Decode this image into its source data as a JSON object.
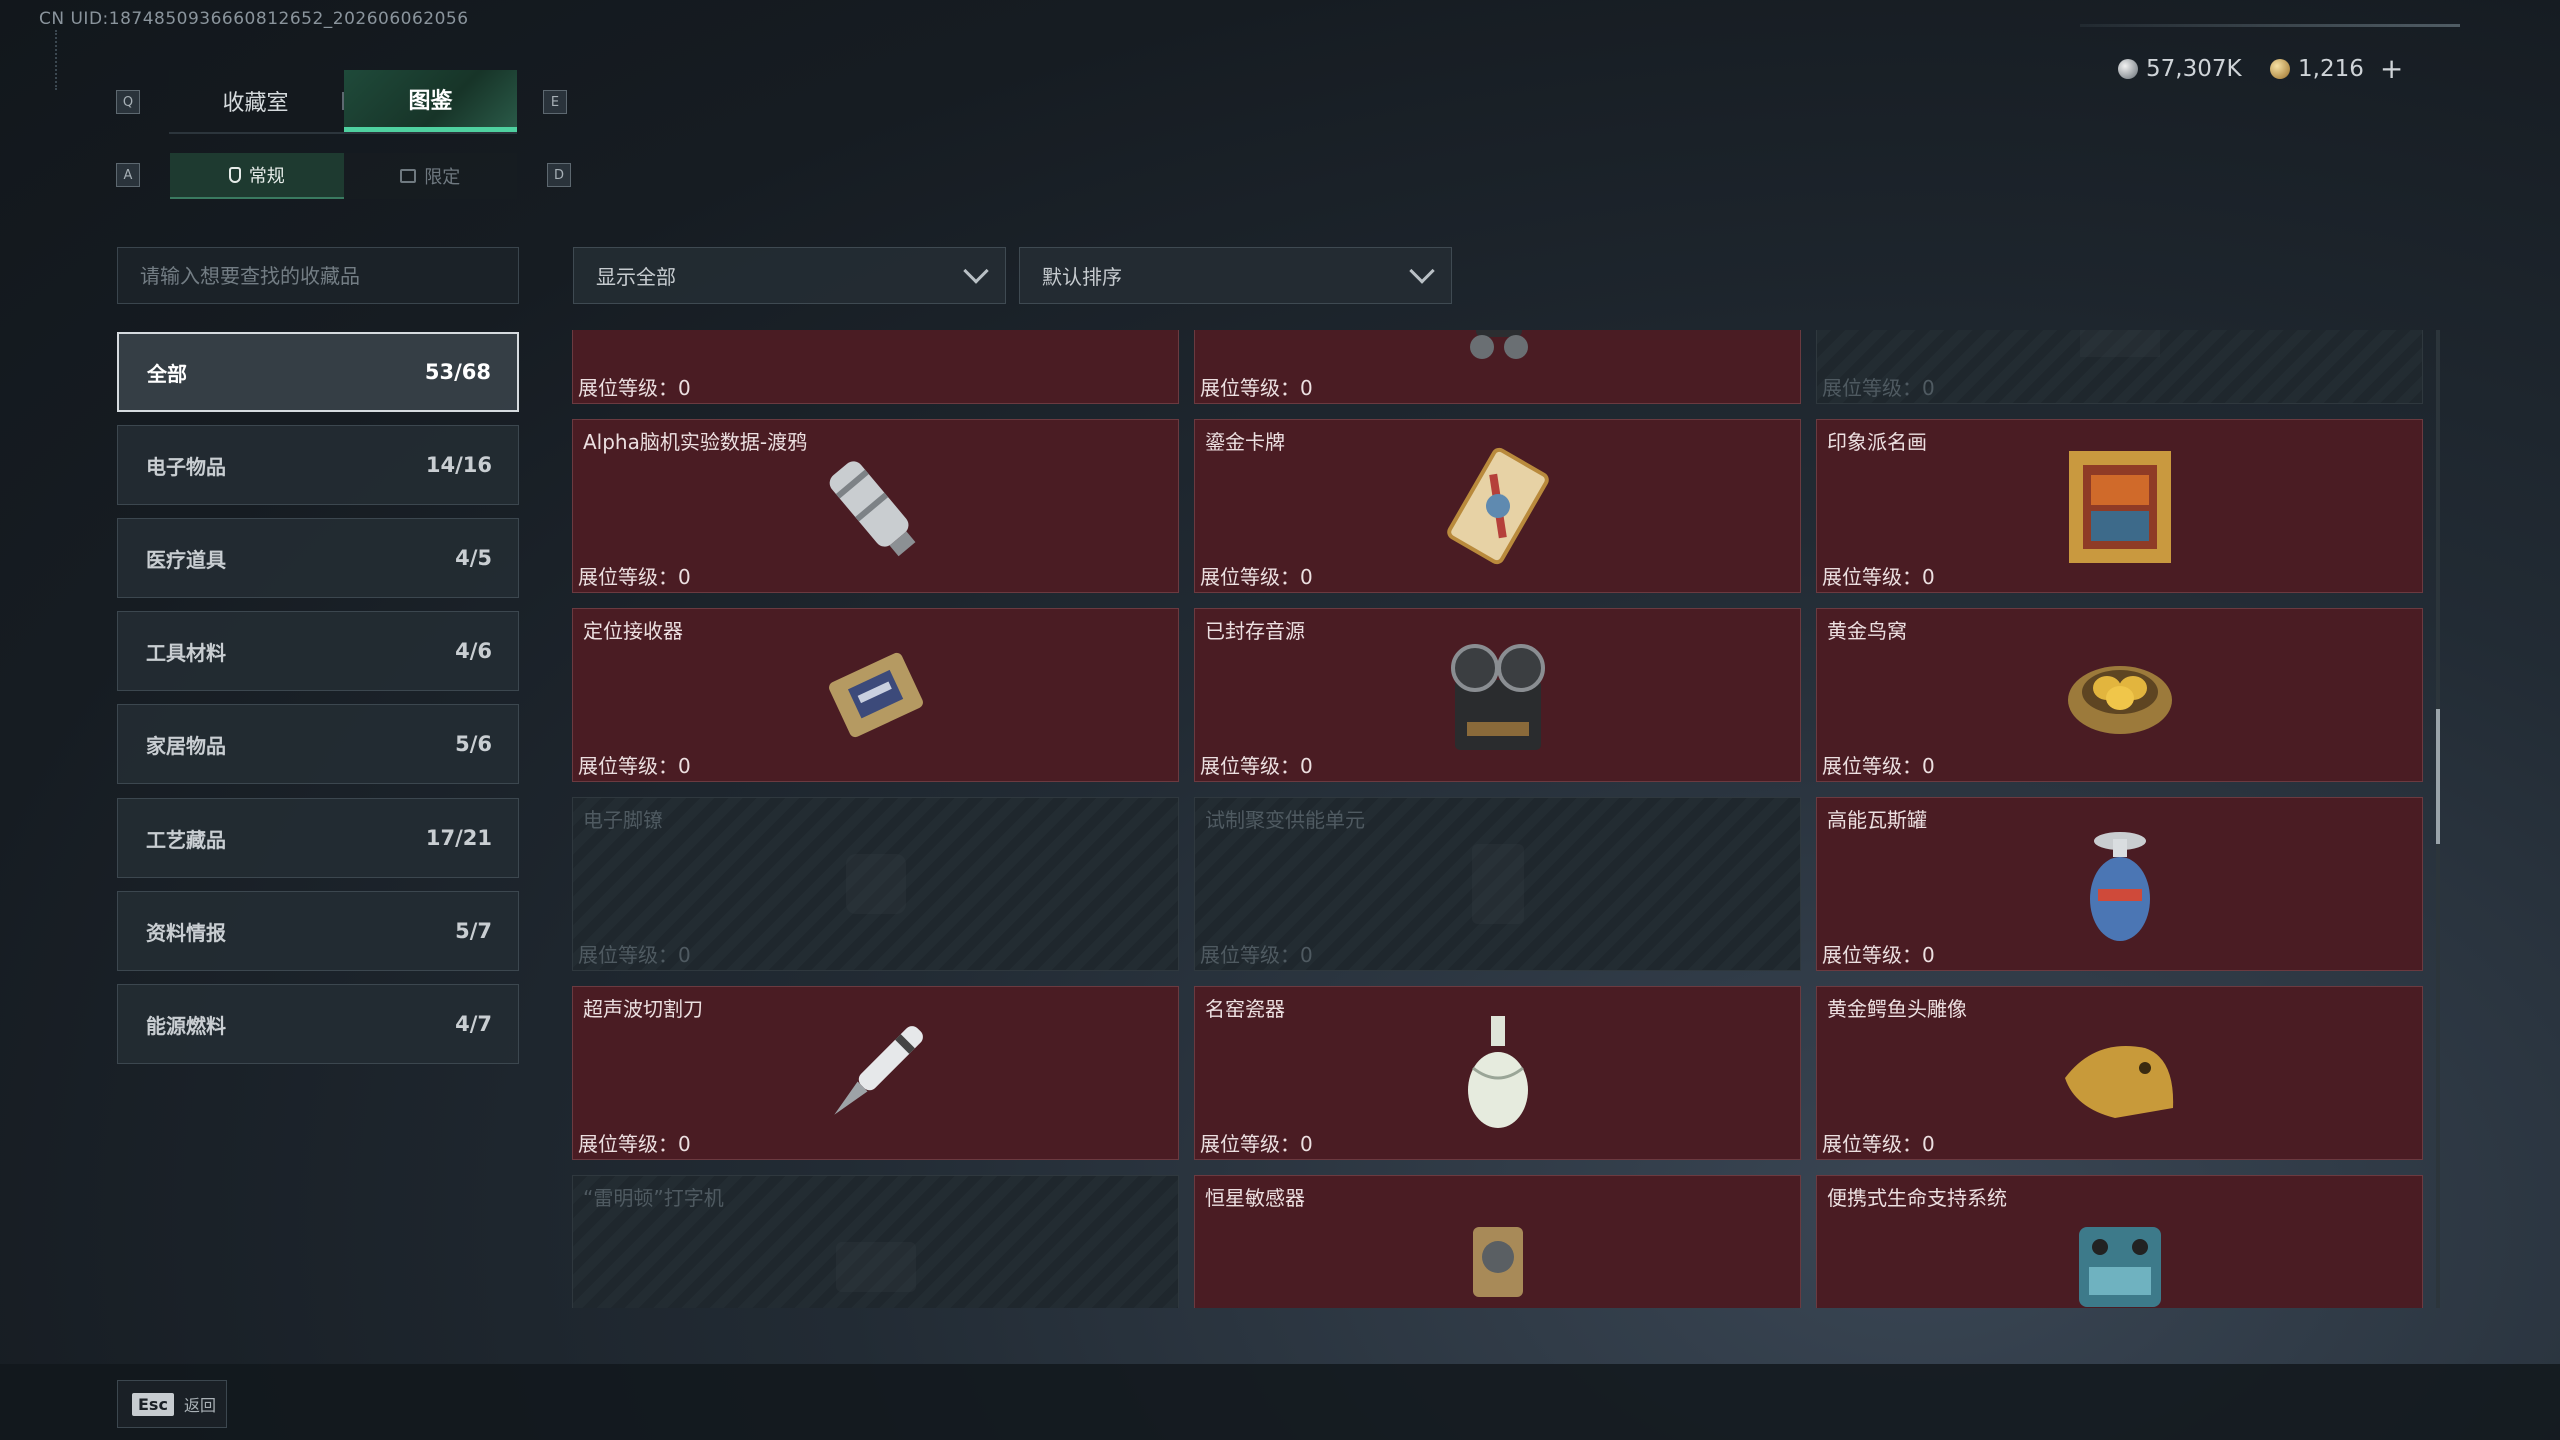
{
  "uid": "CN UID:1874850936660812652_202606062056",
  "currency": {
    "silver": "57,307K",
    "gold": "1,216",
    "plus": "+"
  },
  "keys": {
    "prev_tab": "Q",
    "next_tab": "E",
    "prev_sub": "A",
    "next_sub": "D"
  },
  "tabs": [
    {
      "label": "收藏室",
      "active": false
    },
    {
      "label": "图鉴",
      "active": true
    }
  ],
  "subtabs": [
    {
      "label": "常规",
      "active": true
    },
    {
      "label": "限定",
      "active": false
    }
  ],
  "search": {
    "placeholder": "请输入想要查找的收藏品"
  },
  "filters": {
    "show": "显示全部",
    "sort": "默认排序"
  },
  "categories": [
    {
      "label": "全部",
      "count": "53/68",
      "active": true
    },
    {
      "label": "电子物品",
      "count": "14/16"
    },
    {
      "label": "医疗道具",
      "count": "4/5"
    },
    {
      "label": "工具材料",
      "count": "4/6"
    },
    {
      "label": "家居物品",
      "count": "5/6"
    },
    {
      "label": "工艺藏品",
      "count": "17/21"
    },
    {
      "label": "资料情报",
      "count": "5/7"
    },
    {
      "label": "能源燃料",
      "count": "4/7"
    }
  ],
  "level_label": "展位等级：0",
  "items": [
    {
      "name": "",
      "level": "展位等级：0",
      "locked": false,
      "icon": "caviar-tin-icon"
    },
    {
      "name": "",
      "level": "展位等级：0",
      "locked": false,
      "icon": "radio-device-icon"
    },
    {
      "name": "",
      "level": "展位等级：0",
      "locked": true,
      "icon": "unknown-item-icon"
    },
    {
      "name": "Alpha脑机实验数据-渡鸦",
      "level": "展位等级：0",
      "locked": false,
      "icon": "data-canister-icon"
    },
    {
      "name": "鎏金卡牌",
      "level": "展位等级：0",
      "locked": false,
      "icon": "gilded-card-icon"
    },
    {
      "name": "印象派名画",
      "level": "展位等级：0",
      "locked": false,
      "icon": "painting-icon"
    },
    {
      "name": "定位接收器",
      "level": "展位等级：0",
      "locked": false,
      "icon": "locator-receiver-icon"
    },
    {
      "name": "已封存音源",
      "level": "展位等级：0",
      "locked": false,
      "icon": "reel-recorder-icon"
    },
    {
      "name": "黄金鸟窝",
      "level": "展位等级：0",
      "locked": false,
      "icon": "golden-nest-icon"
    },
    {
      "name": "电子脚镣",
      "level": "展位等级：0",
      "locked": true,
      "icon": "ankle-monitor-icon"
    },
    {
      "name": "试制聚变供能单元",
      "level": "展位等级：0",
      "locked": true,
      "icon": "fusion-cell-icon"
    },
    {
      "name": "高能瓦斯罐",
      "level": "展位等级：0",
      "locked": false,
      "icon": "gas-canister-icon"
    },
    {
      "name": "超声波切割刀",
      "level": "展位等级：0",
      "locked": false,
      "icon": "ultrasonic-knife-icon"
    },
    {
      "name": "名窑瓷器",
      "level": "展位等级：0",
      "locked": false,
      "icon": "porcelain-vase-icon"
    },
    {
      "name": "黄金鳄鱼头雕像",
      "level": "展位等级：0",
      "locked": false,
      "icon": "crocodile-statue-icon"
    },
    {
      "name": "“雷明顿”打字机",
      "level": "",
      "locked": true,
      "icon": "typewriter-icon"
    },
    {
      "name": "恒星敏感器",
      "level": "",
      "locked": false,
      "icon": "star-sensor-icon"
    },
    {
      "name": "便携式生命支持系统",
      "level": "",
      "locked": false,
      "icon": "life-support-icon"
    }
  ],
  "scroll": {
    "position": 0.45
  },
  "footer": {
    "esc_key": "Esc",
    "esc_label": "返回"
  },
  "colors": {
    "accent": "#4fd1a0",
    "card": "#4a1c23",
    "locked": "#1f272d"
  }
}
